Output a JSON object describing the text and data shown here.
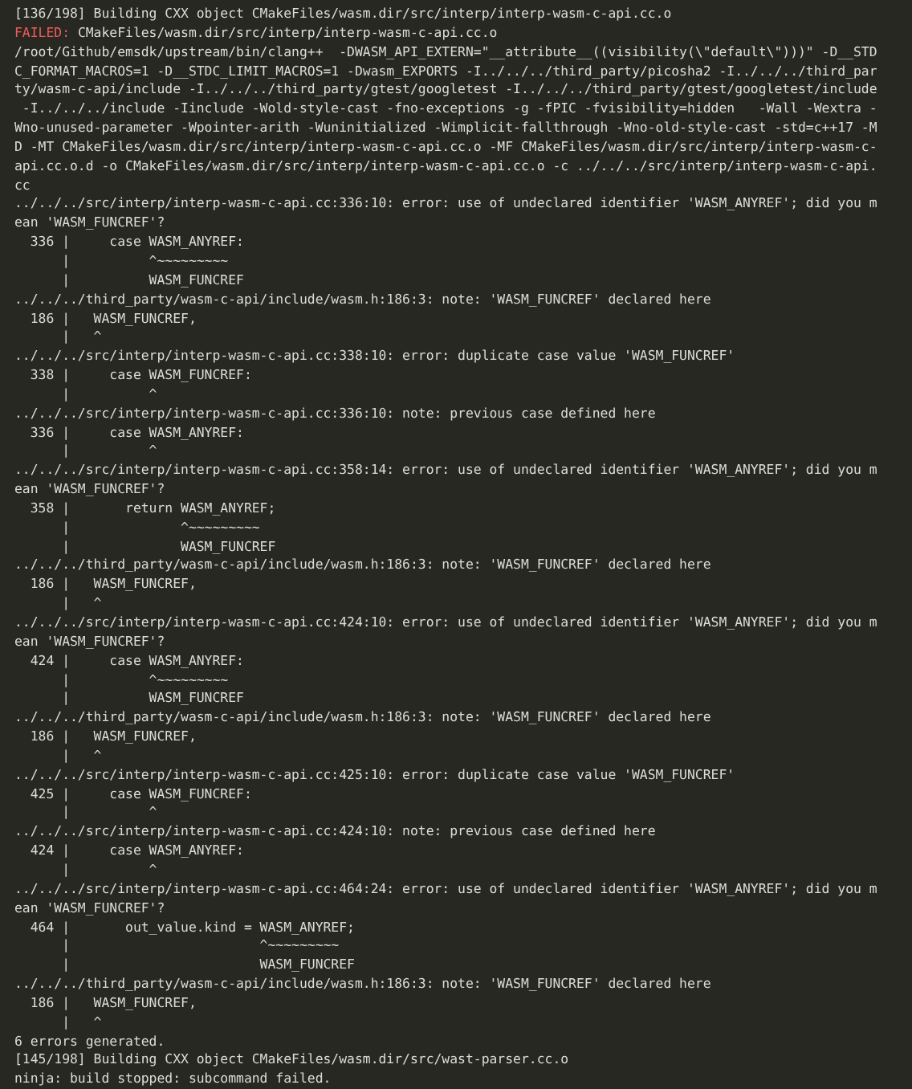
{
  "terminal": {
    "lines": [
      {
        "kind": "plain",
        "text": "[136/198] Building CXX object CMakeFiles/wasm.dir/src/interp/interp-wasm-c-api.cc.o"
      },
      {
        "kind": "failed",
        "label": "FAILED:",
        "text": " CMakeFiles/wasm.dir/src/interp/interp-wasm-c-api.cc.o"
      },
      {
        "kind": "plain",
        "text": "/root/Github/emsdk/upstream/bin/clang++  -DWASM_API_EXTERN=\"__attribute__((visibility(\\\"default\\\")))\" -D__STD"
      },
      {
        "kind": "plain",
        "text": "C_FORMAT_MACROS=1 -D__STDC_LIMIT_MACROS=1 -Dwasm_EXPORTS -I../../../third_party/picosha2 -I../../../third_par"
      },
      {
        "kind": "plain",
        "text": "ty/wasm-c-api/include -I../../../third_party/gtest/googletest -I../../../third_party/gtest/googletest/include"
      },
      {
        "kind": "plain",
        "text": " -I../../../include -Iinclude -Wold-style-cast -fno-exceptions -g -fPIC -fvisibility=hidden   -Wall -Wextra -"
      },
      {
        "kind": "plain",
        "text": "Wno-unused-parameter -Wpointer-arith -Wuninitialized -Wimplicit-fallthrough -Wno-old-style-cast -std=c++17 -M"
      },
      {
        "kind": "plain",
        "text": "D -MT CMakeFiles/wasm.dir/src/interp/interp-wasm-c-api.cc.o -MF CMakeFiles/wasm.dir/src/interp/interp-wasm-c-"
      },
      {
        "kind": "plain",
        "text": "api.cc.o.d -o CMakeFiles/wasm.dir/src/interp/interp-wasm-c-api.cc.o -c ../../../src/interp/interp-wasm-c-api."
      },
      {
        "kind": "plain",
        "text": "cc"
      },
      {
        "kind": "plain",
        "text": "../../../src/interp/interp-wasm-c-api.cc:336:10: error: use of undeclared identifier 'WASM_ANYREF'; did you m"
      },
      {
        "kind": "plain",
        "text": "ean 'WASM_FUNCREF'?"
      },
      {
        "kind": "plain",
        "text": "  336 |     case WASM_ANYREF:"
      },
      {
        "kind": "plain",
        "text": "      |          ^~~~~~~~~~"
      },
      {
        "kind": "plain",
        "text": "      |          WASM_FUNCREF"
      },
      {
        "kind": "plain",
        "text": "../../../third_party/wasm-c-api/include/wasm.h:186:3: note: 'WASM_FUNCREF' declared here"
      },
      {
        "kind": "plain",
        "text": "  186 |   WASM_FUNCREF,"
      },
      {
        "kind": "plain",
        "text": "      |   ^"
      },
      {
        "kind": "plain",
        "text": "../../../src/interp/interp-wasm-c-api.cc:338:10: error: duplicate case value 'WASM_FUNCREF'"
      },
      {
        "kind": "plain",
        "text": "  338 |     case WASM_FUNCREF:"
      },
      {
        "kind": "plain",
        "text": "      |          ^"
      },
      {
        "kind": "plain",
        "text": "../../../src/interp/interp-wasm-c-api.cc:336:10: note: previous case defined here"
      },
      {
        "kind": "plain",
        "text": "  336 |     case WASM_ANYREF:"
      },
      {
        "kind": "plain",
        "text": "      |          ^"
      },
      {
        "kind": "plain",
        "text": "../../../src/interp/interp-wasm-c-api.cc:358:14: error: use of undeclared identifier 'WASM_ANYREF'; did you m"
      },
      {
        "kind": "plain",
        "text": "ean 'WASM_FUNCREF'?"
      },
      {
        "kind": "plain",
        "text": "  358 |       return WASM_ANYREF;"
      },
      {
        "kind": "plain",
        "text": "      |              ^~~~~~~~~~"
      },
      {
        "kind": "plain",
        "text": "      |              WASM_FUNCREF"
      },
      {
        "kind": "plain",
        "text": "../../../third_party/wasm-c-api/include/wasm.h:186:3: note: 'WASM_FUNCREF' declared here"
      },
      {
        "kind": "plain",
        "text": "  186 |   WASM_FUNCREF,"
      },
      {
        "kind": "plain",
        "text": "      |   ^"
      },
      {
        "kind": "plain",
        "text": "../../../src/interp/interp-wasm-c-api.cc:424:10: error: use of undeclared identifier 'WASM_ANYREF'; did you m"
      },
      {
        "kind": "plain",
        "text": "ean 'WASM_FUNCREF'?"
      },
      {
        "kind": "plain",
        "text": "  424 |     case WASM_ANYREF:"
      },
      {
        "kind": "plain",
        "text": "      |          ^~~~~~~~~~"
      },
      {
        "kind": "plain",
        "text": "      |          WASM_FUNCREF"
      },
      {
        "kind": "plain",
        "text": "../../../third_party/wasm-c-api/include/wasm.h:186:3: note: 'WASM_FUNCREF' declared here"
      },
      {
        "kind": "plain",
        "text": "  186 |   WASM_FUNCREF,"
      },
      {
        "kind": "plain",
        "text": "      |   ^"
      },
      {
        "kind": "plain",
        "text": "../../../src/interp/interp-wasm-c-api.cc:425:10: error: duplicate case value 'WASM_FUNCREF'"
      },
      {
        "kind": "plain",
        "text": "  425 |     case WASM_FUNCREF:"
      },
      {
        "kind": "plain",
        "text": "      |          ^"
      },
      {
        "kind": "plain",
        "text": "../../../src/interp/interp-wasm-c-api.cc:424:10: note: previous case defined here"
      },
      {
        "kind": "plain",
        "text": "  424 |     case WASM_ANYREF:"
      },
      {
        "kind": "plain",
        "text": "      |          ^"
      },
      {
        "kind": "plain",
        "text": "../../../src/interp/interp-wasm-c-api.cc:464:24: error: use of undeclared identifier 'WASM_ANYREF'; did you m"
      },
      {
        "kind": "plain",
        "text": "ean 'WASM_FUNCREF'?"
      },
      {
        "kind": "plain",
        "text": "  464 |       out_value.kind = WASM_ANYREF;"
      },
      {
        "kind": "plain",
        "text": "      |                        ^~~~~~~~~~"
      },
      {
        "kind": "plain",
        "text": "      |                        WASM_FUNCREF"
      },
      {
        "kind": "plain",
        "text": "../../../third_party/wasm-c-api/include/wasm.h:186:3: note: 'WASM_FUNCREF' declared here"
      },
      {
        "kind": "plain",
        "text": "  186 |   WASM_FUNCREF,"
      },
      {
        "kind": "plain",
        "text": "      |   ^"
      },
      {
        "kind": "plain",
        "text": "6 errors generated."
      },
      {
        "kind": "plain",
        "text": "[145/198] Building CXX object CMakeFiles/wasm.dir/src/wast-parser.cc.o"
      },
      {
        "kind": "plain",
        "text": "ninja: build stopped: subcommand failed."
      }
    ]
  }
}
